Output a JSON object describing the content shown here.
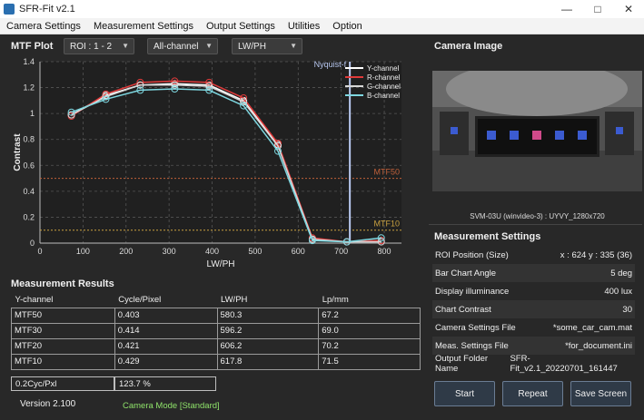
{
  "window": {
    "title": "SFR-Fit v2.1"
  },
  "menu": [
    "Camera Settings",
    "Measurement Settings",
    "Output Settings",
    "Utilities",
    "Option"
  ],
  "mtf_plot": {
    "label": "MTF Plot",
    "roi_select": "ROI : 1 - 2",
    "channel_select": "All-channel",
    "unit_select": "LW/PH"
  },
  "chart_data": {
    "type": "line",
    "xlabel": "LW/PH",
    "ylabel": "Contrast",
    "xlim": [
      0,
      840
    ],
    "ylim": [
      0,
      1.4
    ],
    "xticks": [
      0,
      100,
      200,
      300,
      400,
      500,
      600,
      700,
      800
    ],
    "yticks": [
      0,
      0.2,
      0.4,
      0.6,
      0.8,
      1.0,
      1.2,
      1.4
    ],
    "ytick_labels": [
      "0",
      "0.2",
      "0.4",
      "0.6",
      "0.8",
      "1",
      "1.2",
      "1.4"
    ],
    "x": [
      73,
      153,
      233,
      313,
      393,
      473,
      553,
      633,
      713,
      793
    ],
    "series": [
      {
        "name": "Y-channel",
        "color": "#ffffff",
        "values": [
          0.99,
          1.14,
          1.22,
          1.23,
          1.22,
          1.1,
          0.76,
          0.03,
          0.01,
          0.02
        ]
      },
      {
        "name": "R-channel",
        "color": "#e03a3a",
        "values": [
          0.98,
          1.15,
          1.24,
          1.25,
          1.24,
          1.12,
          0.77,
          0.04,
          0.01,
          0.02
        ]
      },
      {
        "name": "G-channel",
        "color": "#d8d8d8",
        "values": [
          0.99,
          1.13,
          1.22,
          1.22,
          1.21,
          1.09,
          0.75,
          0.03,
          0.01,
          0.01
        ]
      },
      {
        "name": "B-channel",
        "color": "#7ed7e0",
        "values": [
          1.01,
          1.11,
          1.18,
          1.19,
          1.18,
          1.06,
          0.71,
          0.02,
          0.01,
          0.04
        ]
      }
    ],
    "mtf50_line": {
      "label": "MTF50",
      "y": 0.5,
      "color": "#c0603a"
    },
    "mtf10_line": {
      "label": "MTF10",
      "y": 0.1,
      "color": "#c8a040"
    },
    "nyquist": {
      "label": "Nyquist-f",
      "x": 720,
      "color": "#b8c8f0"
    },
    "legend_position": "top-right",
    "grid": true
  },
  "camera_image": {
    "label": "Camera Image",
    "caption": "SVM-03U (winvideo-3) : UYVY_1280x720"
  },
  "measurement_results": {
    "label": "Measurement Results",
    "headers": [
      "Y-channel",
      "Cycle/Pixel",
      "LW/PH",
      "Lp/mm"
    ],
    "rows": [
      [
        "MTF50",
        "0.403",
        "580.3",
        "67.2"
      ],
      [
        "MTF30",
        "0.414",
        "596.2",
        "69.0"
      ],
      [
        "MTF20",
        "0.421",
        "606.2",
        "70.2"
      ],
      [
        "MTF10",
        "0.429",
        "617.8",
        "71.5"
      ]
    ]
  },
  "custom_freq": {
    "label": "0.2Cyc/Pxl",
    "value": "123.7 %"
  },
  "status": {
    "version": "Version 2.100",
    "camera_mode": "Camera Mode [Standard]"
  },
  "measurement_settings": {
    "label": "Measurement Settings",
    "rows": [
      {
        "name": "ROI Position (Size)",
        "value": "x : 624    y : 335     (36)"
      },
      {
        "name": "Bar Chart Angle",
        "value": "5 deg"
      },
      {
        "name": "Display illuminance",
        "value": "400 lux"
      },
      {
        "name": "Chart Contrast",
        "value": "30"
      },
      {
        "name": "Camera Settings File",
        "value": "*some_car_cam.mat"
      },
      {
        "name": "Meas. Settings File",
        "value": "*for_document.ini"
      },
      {
        "name": "Output Folder Name",
        "value": "SFR-Fit_v2.1_20220701_161447"
      }
    ]
  },
  "buttons": {
    "start": "Start",
    "repeat": "Repeat",
    "save_screen": "Save Screen"
  }
}
